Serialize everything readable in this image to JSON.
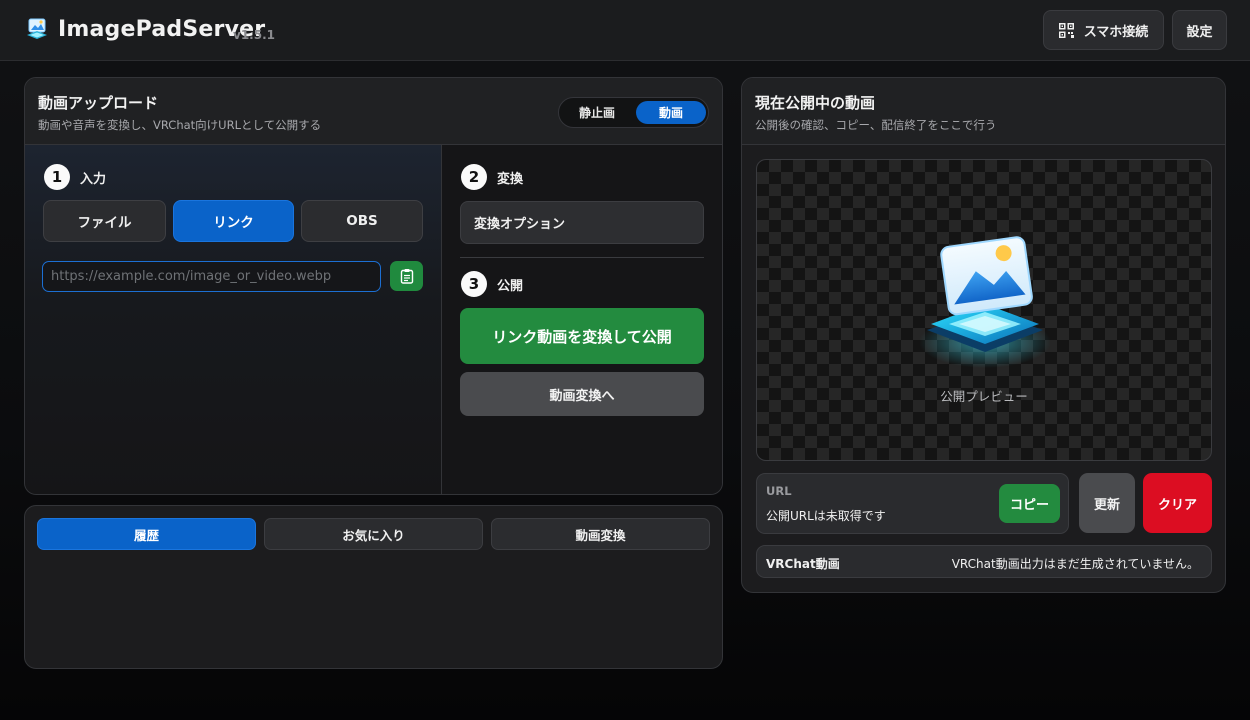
{
  "header": {
    "app_name": "ImagePadServer",
    "version": "v1.5.1",
    "qr_button": "スマホ接続",
    "settings_button": "設定"
  },
  "upload": {
    "title": "動画アップロード",
    "subtitle": "動画や音声を変換し、VRChat向けURLとして公開する",
    "mode_still": "静止画",
    "mode_video": "動画",
    "step1_num": "1",
    "step1_label": "入力",
    "src_file": "ファイル",
    "src_link": "リンク",
    "src_obs": "OBS",
    "url_placeholder": "https://example.com/image_or_video.webp",
    "step2_num": "2",
    "step2_label": "変換",
    "convert_options": "変換オプション",
    "step3_num": "3",
    "step3_label": "公開",
    "publish_button": "リンク動画を変換して公開",
    "to_convert_button": "動画変換へ"
  },
  "publish": {
    "title": "現在公開中の動画",
    "subtitle": "公開後の確認、コピー、配信終了をここで行う",
    "preview_label": "公開プレビュー",
    "url_heading": "URL",
    "url_status": "公開URLは未取得です",
    "copy_button": "コピー",
    "refresh_button": "更新",
    "clear_button": "クリア",
    "vrchat_label": "VRChat動画",
    "vrchat_status": "VRChat動画出力はまだ生成されていません。"
  },
  "history": {
    "tab_history": "履歴",
    "tab_favorites": "お気に入り",
    "tab_video_convert": "動画変換"
  },
  "colors": {
    "accent_blue": "#0a63c9",
    "action_green": "#238b3f",
    "danger_red": "#dc0d22"
  },
  "icons": {
    "logo": "app-logo-icon",
    "qr": "qr-code-icon",
    "paste": "clipboard-icon",
    "preview": "image-preview-icon"
  }
}
